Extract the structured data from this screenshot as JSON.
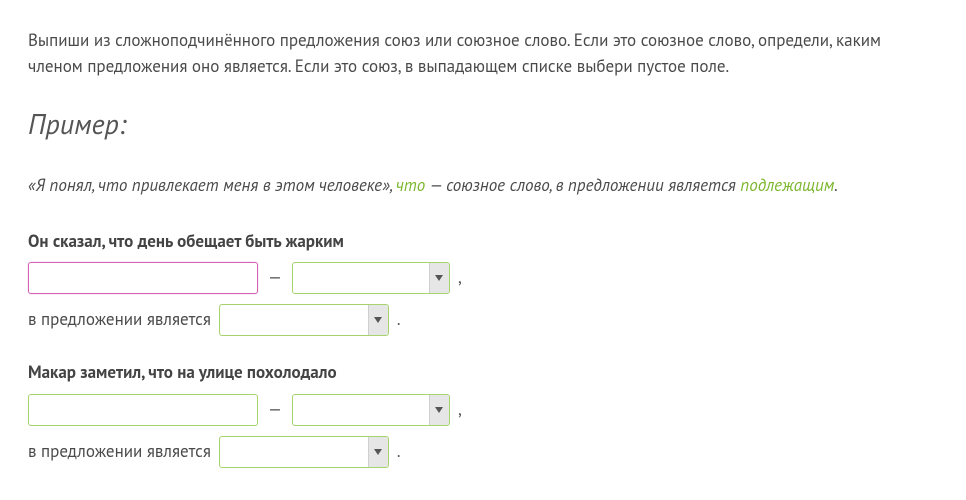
{
  "instructions": "Выпиши из сложноподчинённого предложения союз или союзное слово. Если это союзное слово, определи, каким членом предложения оно является. Если это союз, в выпадающем списке выбери пустое поле.",
  "example_heading": "Пример:",
  "example": {
    "quote": "«Я понял, что привлекает меня в этом человеке», ",
    "word": "что",
    "mid": " — союзное слово, в предложении является ",
    "role": "подлежащим",
    "end": "."
  },
  "labels": {
    "dash": "—",
    "comma": ",",
    "period": ".",
    "role_prefix": "в предложении является"
  },
  "tasks": [
    {
      "sentence": "Он сказал, что день обещает быть жарким",
      "input_value": "",
      "type_selected": "",
      "role_selected": "",
      "focused": true
    },
    {
      "sentence": "Макар заметил, что на улице похолодало",
      "input_value": "",
      "type_selected": "",
      "role_selected": "",
      "focused": false
    }
  ]
}
